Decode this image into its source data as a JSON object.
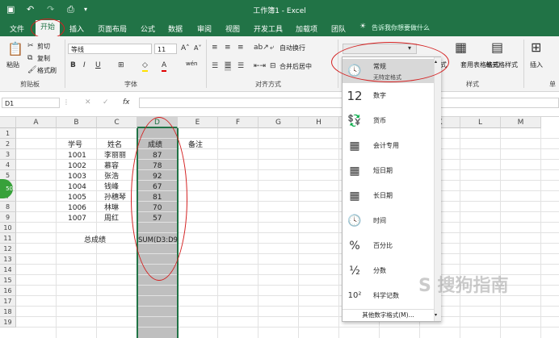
{
  "window": {
    "title": "工作簿1 - Excel"
  },
  "ribbon_tabs": [
    "文件",
    "开始",
    "插入",
    "页面布局",
    "公式",
    "数据",
    "审阅",
    "视图",
    "开发工具",
    "加载项",
    "团队"
  ],
  "active_tab": "开始",
  "tell_me": "告诉我你想要做什么",
  "clipboard": {
    "paste": "粘贴",
    "cut": "剪切",
    "copy": "复制",
    "painter": "格式刷",
    "label": "剪贴板"
  },
  "font": {
    "name": "等线",
    "size": "11",
    "label": "字体",
    "wen": "wén"
  },
  "alignment": {
    "wrap": "自动换行",
    "merge": "合并后居中",
    "label": "对齐方式"
  },
  "styles": {
    "table_format": "套用表格格式",
    "cell_style": "单元格样式",
    "label": "样式",
    "cond_suffix": "式"
  },
  "cells": {
    "insert": "插入",
    "label": "单"
  },
  "formula_bar": {
    "name_box": "D1",
    "fx": "fx"
  },
  "columns": [
    "A",
    "B",
    "C",
    "D",
    "E",
    "F",
    "G",
    "H",
    "I",
    "J",
    "K",
    "L",
    "M"
  ],
  "rows": [
    "1",
    "2",
    "3",
    "4",
    "5",
    "6",
    "7",
    "8",
    "9",
    "10",
    "11",
    "12",
    "13",
    "14",
    "15",
    "16",
    "17",
    "18",
    "19"
  ],
  "sheet": {
    "headers": {
      "id": "学号",
      "name": "姓名",
      "score": "成绩",
      "note": "备注"
    },
    "records": [
      {
        "id": "1001",
        "name": "李丽丽",
        "score": "87"
      },
      {
        "id": "1002",
        "name": "慕容",
        "score": "78"
      },
      {
        "id": "1003",
        "name": "张浩",
        "score": "92"
      },
      {
        "id": "1004",
        "name": "钱峰",
        "score": "67"
      },
      {
        "id": "1005",
        "name": "孙穗琴",
        "score": "81"
      },
      {
        "id": "1006",
        "name": "林琳",
        "score": "70"
      },
      {
        "id": "1007",
        "name": "周红",
        "score": "57"
      }
    ],
    "total_label": "总成绩",
    "total_formula": "SUM(D3:D9"
  },
  "number_format_menu": {
    "items": [
      {
        "icon": "clock-123-icon",
        "label": "常规",
        "sub": "无特定格式"
      },
      {
        "icon": "number-12-icon",
        "label": "数字"
      },
      {
        "icon": "currency-icon",
        "label": "货币"
      },
      {
        "icon": "accounting-icon",
        "label": "会计专用"
      },
      {
        "icon": "short-date-icon",
        "label": "短日期"
      },
      {
        "icon": "long-date-icon",
        "label": "长日期"
      },
      {
        "icon": "time-icon",
        "label": "时间"
      },
      {
        "icon": "percent-icon",
        "label": "百分比"
      },
      {
        "icon": "fraction-icon",
        "label": "分数"
      },
      {
        "icon": "scientific-icon",
        "label": "科学记数"
      }
    ],
    "more": "其他数字格式(M)..."
  },
  "side_badge": "50",
  "watermark": "S 搜狗指南",
  "colors": {
    "excel_green": "#217346",
    "annotation_red": "#d42020",
    "selection": "#bfbfbf"
  }
}
